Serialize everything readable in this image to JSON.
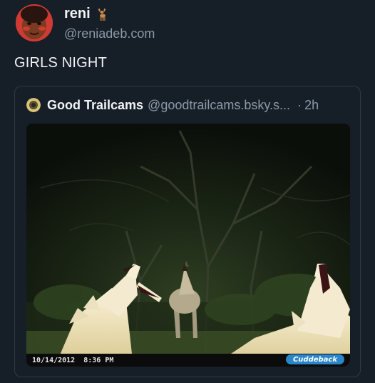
{
  "post": {
    "author": {
      "display_name": "reni",
      "name_icon": "deer-icon",
      "handle": "@reniadeb.com"
    },
    "text": "GIRLS NIGHT"
  },
  "quote": {
    "author": {
      "display_name": "Good Trailcams",
      "handle": "@goodtrailcams.bsky.s...",
      "avatar_icon": "trailcam-avatar-icon"
    },
    "separator": "·",
    "time": "2h",
    "image": {
      "description_kind": "trailcam-photo",
      "timestamp_date": "10/14/2012",
      "timestamp_time": "8:36 PM",
      "brand": "Cuddeback"
    }
  },
  "colors": {
    "background": "#161e27",
    "text_primary": "#f1f3f5",
    "text_secondary": "#8c99a8",
    "card_border": "#2e3a48",
    "brand_badge": "#2a86c8"
  }
}
